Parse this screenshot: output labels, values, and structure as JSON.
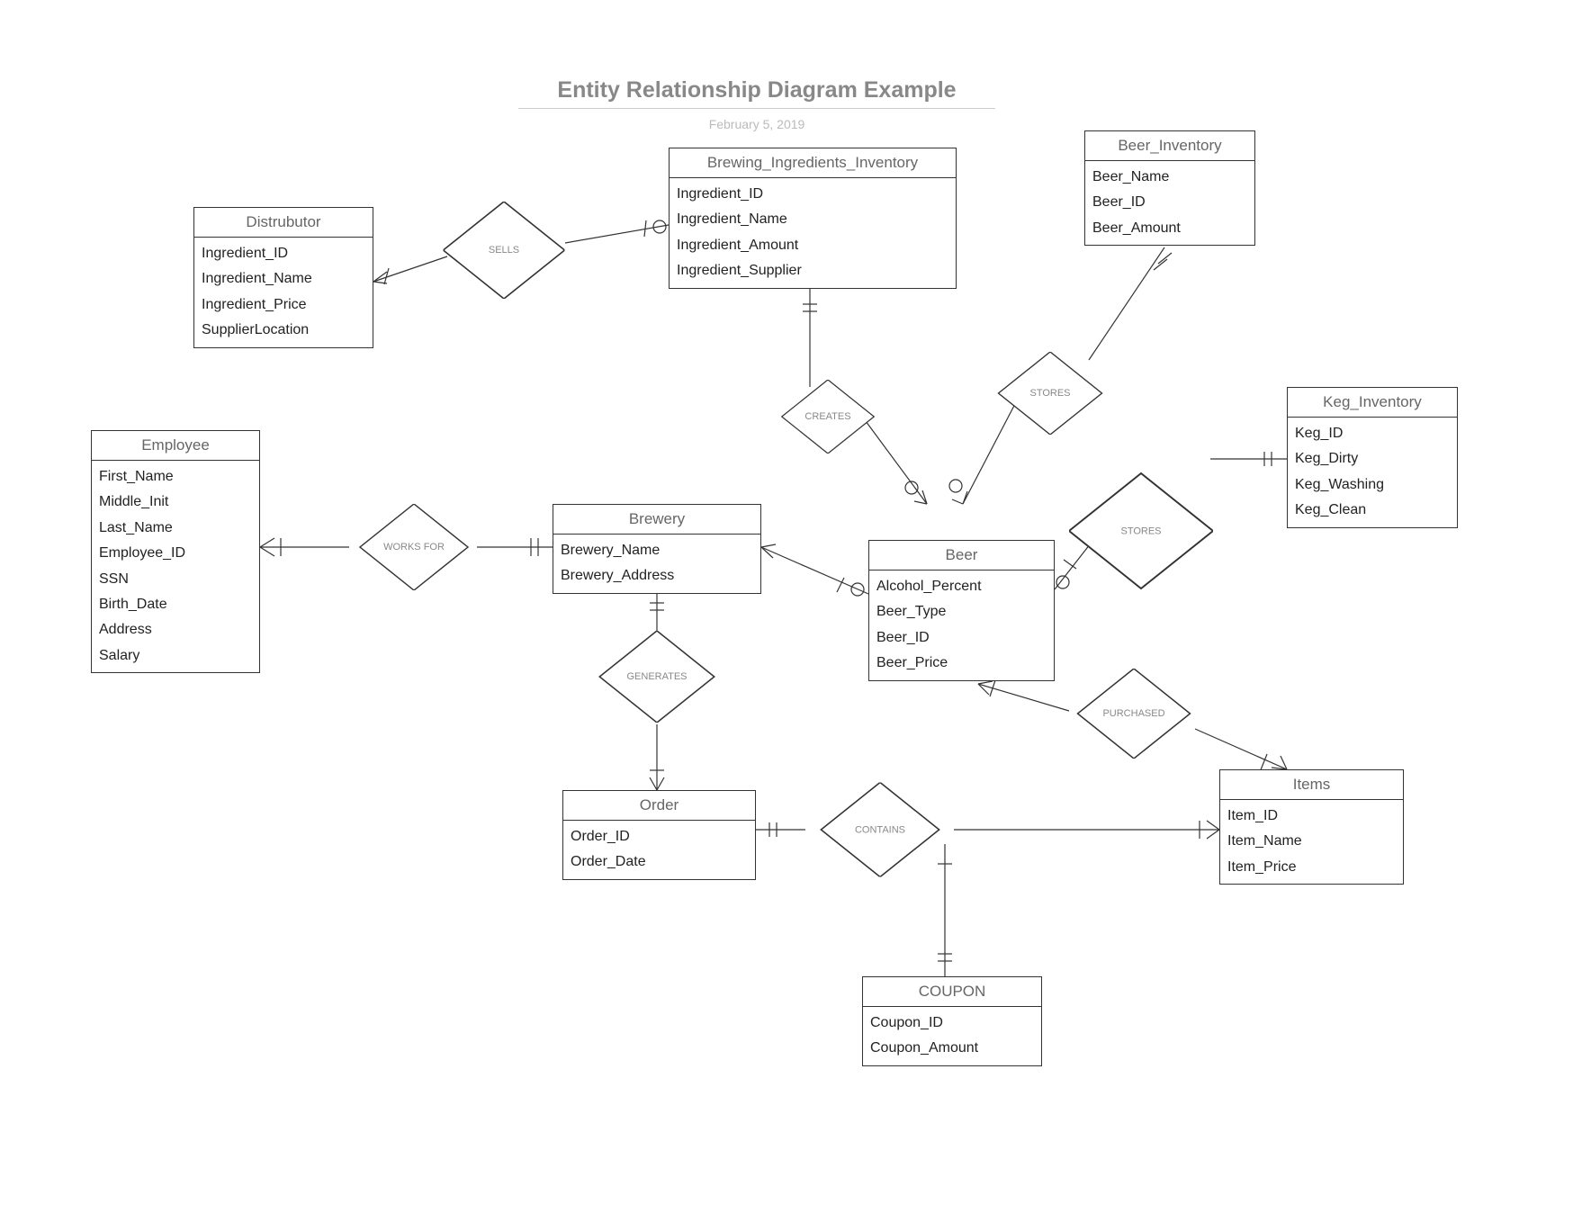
{
  "title": "Entity Relationship Diagram Example",
  "date": "February 5, 2019",
  "entities": {
    "distributor": {
      "title": "Distrubutor",
      "attrs": [
        "Ingredient_ID",
        "Ingredient_Name",
        "Ingredient_Price",
        "SupplierLocation"
      ]
    },
    "brewing_ingredients_inventory": {
      "title": "Brewing_Ingredients_Inventory",
      "attrs": [
        "Ingredient_ID",
        "Ingredient_Name",
        "Ingredient_Amount",
        "Ingredient_Supplier"
      ]
    },
    "beer_inventory": {
      "title": "Beer_Inventory",
      "attrs": [
        "Beer_Name",
        "Beer_ID",
        "Beer_Amount"
      ]
    },
    "employee": {
      "title": "Employee",
      "attrs": [
        "First_Name",
        "Middle_Init",
        "Last_Name",
        "Employee_ID",
        "SSN",
        "Birth_Date",
        "Address",
        "Salary"
      ]
    },
    "keg_inventory": {
      "title": "Keg_Inventory",
      "attrs": [
        "Keg_ID",
        "Keg_Dirty",
        "Keg_Washing",
        "Keg_Clean"
      ]
    },
    "brewery": {
      "title": "Brewery",
      "attrs": [
        "Brewery_Name",
        "Brewery_Address"
      ]
    },
    "beer": {
      "title": "Beer",
      "attrs": [
        "Alcohol_Percent",
        "Beer_Type",
        "Beer_ID",
        "Beer_Price"
      ]
    },
    "order": {
      "title": "Order",
      "attrs": [
        "Order_ID",
        "Order_Date"
      ]
    },
    "items": {
      "title": "Items",
      "attrs": [
        "Item_ID",
        "Item_Name",
        "Item_Price"
      ]
    },
    "coupon": {
      "title": "COUPON",
      "attrs": [
        "Coupon_ID",
        "Coupon_Amount"
      ]
    }
  },
  "relationships": {
    "sells": "SELLS",
    "creates": "CREATES",
    "stores1": "STORES",
    "stores2": "STORES",
    "works_for": "WORKS FOR",
    "generates": "GENERATES",
    "purchased": "PURCHASED",
    "contains": "CONTAINS"
  }
}
